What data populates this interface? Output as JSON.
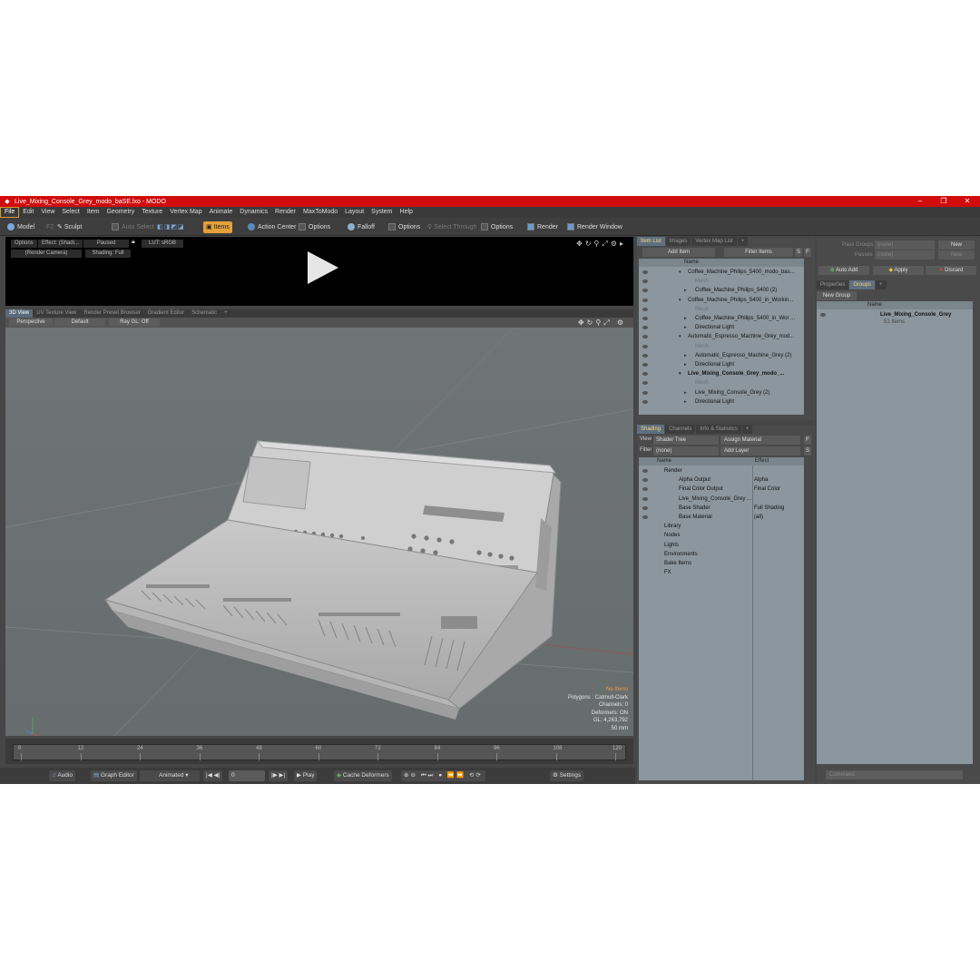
{
  "window": {
    "title": "Live_Mixing_Console_Grey_modo_baSE.lxo - MODO",
    "min": "–",
    "max": "❐",
    "close": "✕"
  },
  "menu": [
    "File",
    "Edit",
    "View",
    "Select",
    "Item",
    "Geometry",
    "Texture",
    "Vertex Map",
    "Animate",
    "Dynamics",
    "Render",
    "MaxToModo",
    "Layout",
    "System",
    "Help"
  ],
  "toolbar": {
    "model": "Model",
    "f2": "F2",
    "sculpt": "Sculpt",
    "auto_select": "Auto Select",
    "items": "Items",
    "action_center": "Action Center",
    "options1": "Options",
    "falloff": "Falloff",
    "options2": "Options",
    "select_through": "Select Through",
    "options3": "Options",
    "render": "Render",
    "render_window": "Render Window"
  },
  "preview": {
    "options": "Options",
    "effect": "Effect: (Shadi...",
    "paused": "Paused",
    "lut": "LUT: sRGB",
    "camera": "(Render Camera)",
    "shading": "Shading: Full"
  },
  "viewport_tabs": [
    "3D View",
    "UV Texture View",
    "Render Preset Browser",
    "Gradient Editor",
    "Schematic",
    "+"
  ],
  "viewport_bar": {
    "perspective": "Perspective",
    "default": "Default",
    "raygl": "Ray GL: Off"
  },
  "viewport_info": {
    "no_items": "No Items",
    "polygons": "Polygons : Catmull-Clark",
    "channels": "Channels: 0",
    "deformers": "Deformers: ON",
    "gl": "GL: 4,263,792",
    "focal": "50 mm"
  },
  "timeline": {
    "ticks": [
      "0",
      "12",
      "24",
      "36",
      "48",
      "60",
      "72",
      "84",
      "96",
      "108",
      "120"
    ],
    "start": "0",
    "mid": "120",
    "end": "120"
  },
  "bottom": {
    "audio": "Audio",
    "graph_editor": "Graph Editor",
    "animated": "Animated",
    "frame": "0",
    "play": "Play",
    "cache": "Cache Deformers",
    "settings": "Settings"
  },
  "item_list": {
    "tabs": [
      "Item List",
      "Images",
      "Vertex Map List",
      "+"
    ],
    "add_item": "Add Item",
    "filter_items": "Filter Items",
    "s": "S",
    "f": "F",
    "col_name": "Name",
    "rows": [
      {
        "label": "Coffee_Machine_Philips_5400_modo_bas...",
        "indent": 0,
        "style": "n"
      },
      {
        "label": "Mesh",
        "indent": 1,
        "style": "dim"
      },
      {
        "label": "Coffee_Machine_Philips_5400 (2)",
        "indent": 1,
        "style": "n"
      },
      {
        "label": "Coffee_Machine_Philips_5400_in_Workin...",
        "indent": 0,
        "style": "n"
      },
      {
        "label": "Mesh",
        "indent": 1,
        "style": "dim"
      },
      {
        "label": "Coffee_Machine_Philips_5400_in_Wor ...",
        "indent": 1,
        "style": "n"
      },
      {
        "label": "Directional Light",
        "indent": 1,
        "style": "n"
      },
      {
        "label": "Automatic_Espresso_Machine_Grey_mod...",
        "indent": 0,
        "style": "n"
      },
      {
        "label": "Mesh",
        "indent": 1,
        "style": "dim"
      },
      {
        "label": "Automatic_Espresso_Machine_Grey (2)",
        "indent": 1,
        "style": "n"
      },
      {
        "label": "Directional Light",
        "indent": 1,
        "style": "n"
      },
      {
        "label": "Live_Mixing_Console_Grey_modo_...",
        "indent": 0,
        "style": "b"
      },
      {
        "label": "Mesh",
        "indent": 1,
        "style": "dim"
      },
      {
        "label": "Live_Mixing_Console_Grey (2)",
        "indent": 1,
        "style": "n"
      },
      {
        "label": "Directional Light",
        "indent": 1,
        "style": "n"
      }
    ]
  },
  "shading": {
    "tabs": [
      "Shading",
      "Channels",
      "Info & Statistics",
      "+"
    ],
    "view_label": "View",
    "view_value": "Shader Tree",
    "assign": "Assign Material",
    "f": "F",
    "filter_label": "Filter",
    "filter_value": "(none)",
    "add_layer": "Add Layer",
    "s": "S",
    "col_name": "Name",
    "col_effect": "Effect",
    "rows": [
      {
        "label": "Render",
        "effect": "",
        "indent": 0
      },
      {
        "label": "Alpha Output",
        "effect": "Alpha",
        "indent": 1
      },
      {
        "label": "Final Color Output",
        "effect": "Final Color",
        "indent": 1
      },
      {
        "label": "Live_Mixing_Console_Grey ...",
        "effect": "",
        "indent": 1
      },
      {
        "label": "Base Shader",
        "effect": "Full Shading",
        "indent": 1
      },
      {
        "label": "Base Material",
        "effect": "(all)",
        "indent": 1
      },
      {
        "label": "Library",
        "effect": "",
        "indent": 0
      },
      {
        "label": "Nodes",
        "effect": "",
        "indent": 0
      },
      {
        "label": "Lights",
        "effect": "",
        "indent": 0
      },
      {
        "label": "Environments",
        "effect": "",
        "indent": 0
      },
      {
        "label": "Bake Items",
        "effect": "",
        "indent": 0
      },
      {
        "label": "FX",
        "effect": "",
        "indent": 0
      }
    ]
  },
  "groups": {
    "pass_groups": "Pass Groups",
    "pass_value": "(none)",
    "new": "New",
    "passes": "Passes",
    "passes_value": "(none)",
    "new2": "New",
    "auto_add": "Auto Add",
    "apply": "Apply",
    "discard": "Discard",
    "tabs": [
      "Properties",
      "Groups",
      "+"
    ],
    "new_group": "New Group",
    "col_name": "Name",
    "group_name": "Live_Mixing_Console_Grey",
    "group_count": "51 Items"
  },
  "command": {
    "placeholder": "Command"
  }
}
